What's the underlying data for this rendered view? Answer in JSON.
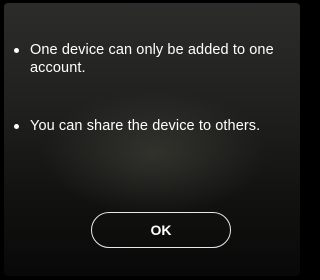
{
  "dialog": {
    "bullets": [
      "One device can only be added to one account.",
      "You can share the device to others."
    ],
    "ok_label": "OK"
  }
}
